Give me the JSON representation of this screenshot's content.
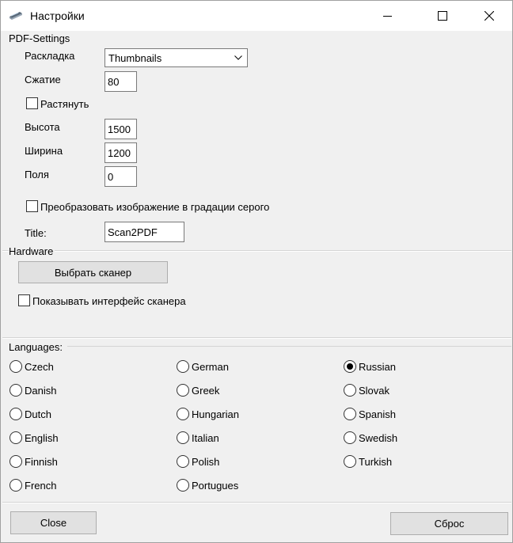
{
  "window": {
    "title": "Настройки"
  },
  "pdf_settings": {
    "header": "PDF-Settings",
    "layout_label": "Раскладка",
    "layout_value": "Thumbnails",
    "compression_label": "Сжатие",
    "compression_value": "80",
    "stretch_label": "Растянуть",
    "stretch_checked": false,
    "height_label": "Высота",
    "height_value": "1500",
    "width_label": "Ширина",
    "width_value": "1200",
    "margins_label": "Поля",
    "margins_value": "0",
    "grayscale_label": "Преобразовать изображение в градации серого",
    "grayscale_checked": false,
    "title_label": "Title:",
    "title_value": "Scan2PDF"
  },
  "hardware": {
    "header": "Hardware",
    "select_scanner_label": "Выбрать сканер",
    "show_interface_label": "Показывать интерфейс сканера",
    "show_interface_checked": false
  },
  "languages": {
    "header": "Languages:",
    "selected": "Russian",
    "items": [
      "Czech",
      "Danish",
      "Dutch",
      "English",
      "Finnish",
      "French",
      "German",
      "Greek",
      "Hungarian",
      "Italian",
      "Polish",
      "Portugues",
      "Russian",
      "Slovak",
      "Spanish",
      "Swedish",
      "Turkish"
    ]
  },
  "footer": {
    "close_label": "Close",
    "reset_label": "Сброс"
  }
}
